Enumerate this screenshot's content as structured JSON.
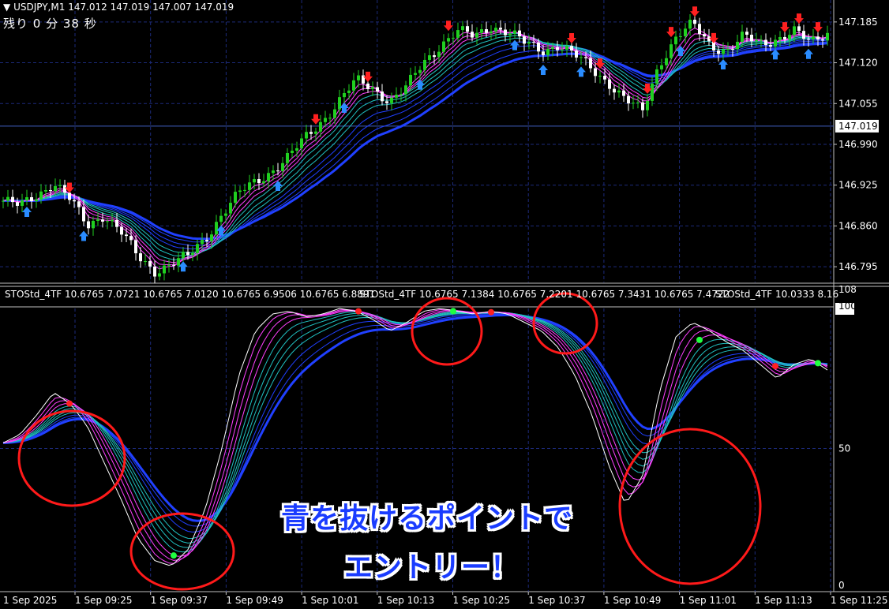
{
  "header": {
    "symbol": "USDJPY,M1",
    "ohlc": "147.012 147.019 147.007 147.019",
    "timer": "残り 0 分 38 秒"
  },
  "indicator": {
    "label_1": "STOStd_4TF 10.6765 7.0721 10.6765 7.0120 10.6765 6.9506 10.6765 6.8891",
    "label_2": "STOStd_4TF 10.6765 7.1384 10.6765 7.2201 10.6765 7.3431 10.6765 7.4722",
    "label_3": "STOStd_4TF 10.0333 8.16"
  },
  "price_axis": {
    "ticks": [
      "147.185",
      "147.120",
      "147.055",
      "146.990",
      "146.925",
      "146.860",
      "146.795"
    ],
    "current": "147.019"
  },
  "osc_axis": {
    "ticks": [
      "108",
      "100",
      "50",
      "0"
    ]
  },
  "time_axis": {
    "ticks": [
      "1 Sep 2025",
      "1 Sep 09:25",
      "1 Sep 09:37",
      "1 Sep 09:49",
      "1 Sep 10:01",
      "1 Sep 10:13",
      "1 Sep 10:25",
      "1 Sep 10:37",
      "1 Sep 10:49",
      "1 Sep 11:01",
      "1 Sep 11:13",
      "1 Sep 11:25"
    ]
  },
  "overlay_text": {
    "line1": "青を抜けるポイントで",
    "line2": "エントリー！"
  },
  "colors": {
    "background": "#000000",
    "grid": "#1c2a7a",
    "bull": "#20d020",
    "bear": "#ffffff",
    "ribbon_fast": "#ff40ff",
    "ribbon_mid": "#20c0c0",
    "ribbon_slow": "#2040ff",
    "up_arrow": "#2a8cff",
    "down_arrow": "#ff2020",
    "circle": "#ff1a1a",
    "dot_green": "#20ff40",
    "dot_red": "#ff2020"
  },
  "chart_data": {
    "type": "candlestick",
    "symbol": "USDJPY,M1",
    "ylim": [
      146.77,
      147.22
    ],
    "close_path": [
      146.9,
      146.89,
      146.91,
      146.93,
      146.9,
      146.86,
      146.88,
      146.85,
      146.81,
      146.79,
      146.8,
      146.81,
      146.84,
      146.88,
      146.91,
      146.93,
      146.95,
      146.97,
      147.0,
      147.03,
      147.06,
      147.09,
      147.08,
      147.06,
      147.08,
      147.12,
      147.15,
      147.17,
      147.16,
      147.18,
      147.17,
      147.15,
      147.14,
      147.15,
      147.13,
      147.11,
      147.09,
      147.06,
      147.04,
      147.12,
      147.16,
      147.18,
      147.15,
      147.14,
      147.16,
      147.15,
      147.16,
      147.17,
      147.15,
      147.17
    ],
    "osc_path": [
      52,
      55,
      62,
      70,
      66,
      58,
      45,
      32,
      18,
      10,
      8,
      14,
      28,
      50,
      76,
      92,
      98,
      99,
      97,
      98,
      100,
      99,
      96,
      92,
      95,
      99,
      100,
      99,
      98,
      99,
      98,
      95,
      92,
      86,
      76,
      62,
      44,
      30,
      40,
      70,
      90,
      95,
      92,
      88,
      85,
      80,
      75,
      80,
      82,
      78
    ],
    "osc_ylim": [
      0,
      108
    ]
  }
}
